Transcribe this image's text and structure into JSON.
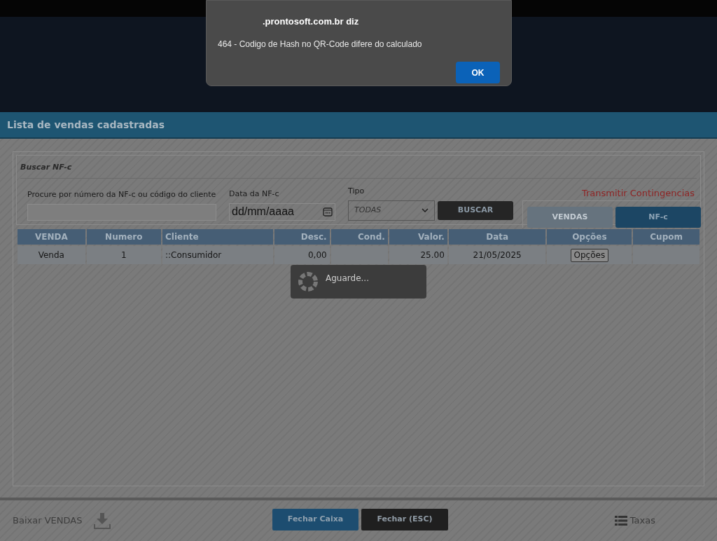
{
  "alert": {
    "origin": ".prontosoft.com.br diz",
    "message": "464 - Codigo de Hash no QR-Code difere do calculado",
    "button": "OK"
  },
  "header": {
    "title": "Lista de vendas cadastradas"
  },
  "search": {
    "legend": "Buscar NF-c",
    "query_label": "Procure por número da NF-c ou código do cliente",
    "date_label": "Data da NF-c",
    "date_value": "dd/mm/aaaa",
    "type_label": "Tipo",
    "type_value": "TODAS",
    "search_button": "BUSCAR",
    "contingency_link": "Transmitir Contingencias"
  },
  "view_tabs": [
    {
      "label": "VENDAS",
      "selected": false
    },
    {
      "label": "NF-c",
      "selected": true
    }
  ],
  "table": {
    "columns": [
      "VENDA",
      "Numero",
      "Cliente",
      "Desc.",
      "Cond.",
      "Valor.",
      "Data",
      "Opções",
      "Cupom"
    ],
    "rows": [
      {
        "cells": [
          "Venda",
          "1",
          "::Consumidor",
          "0,00",
          "",
          "25.00",
          "21/05/2025",
          "Opções",
          ""
        ]
      }
    ]
  },
  "loading": {
    "text": "Aguarde..."
  },
  "footer": {
    "download": "Baixar VENDAS",
    "close_register": "Fechar Caixa",
    "close": "Fechar (ESC)",
    "fees": "Taxas"
  }
}
